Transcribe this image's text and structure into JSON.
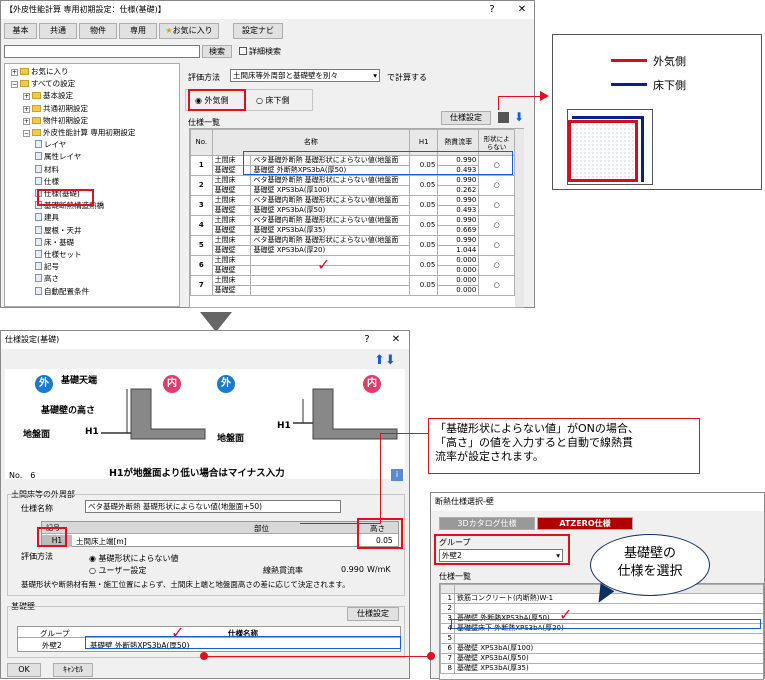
{
  "main_window": {
    "title": "【外皮性能計算 専用初期設定：仕様(基礎)】",
    "help": "?",
    "close": "✕",
    "toolbar": [
      "基本",
      "共通",
      "物件",
      "専用",
      "お気に入り",
      "設定ナビ"
    ],
    "search_button": "検索",
    "detail_search": "詳細検索",
    "tree": [
      {
        "label": "お気に入り",
        "indent": 0
      },
      {
        "label": "すべての設定",
        "indent": 0
      },
      {
        "label": "基本設定",
        "indent": 1
      },
      {
        "label": "共通初期設定",
        "indent": 1
      },
      {
        "label": "物件初期設定",
        "indent": 1
      },
      {
        "label": "外皮性能計算 専用初期設定",
        "indent": 1
      },
      {
        "label": "レイヤ",
        "indent": 2
      },
      {
        "label": "属性レイヤ",
        "indent": 2
      },
      {
        "label": "材料",
        "indent": 2
      },
      {
        "label": "仕様",
        "indent": 2
      },
      {
        "label": "仕様(基礎)",
        "indent": 2
      },
      {
        "label": "基礎断熱構造熱橋",
        "indent": 2
      },
      {
        "label": "建具",
        "indent": 2
      },
      {
        "label": "屋根・天井",
        "indent": 2
      },
      {
        "label": "床・基礎",
        "indent": 2
      },
      {
        "label": "仕様セット",
        "indent": 2
      },
      {
        "label": "記号",
        "indent": 2
      },
      {
        "label": "高さ",
        "indent": 2
      },
      {
        "label": "自動配置条件",
        "indent": 2
      }
    ],
    "eval_label": "評価方法",
    "eval_value": "土間床等外周部と基礎壁を別々",
    "eval_suffix": "で計算する",
    "radio_outside": "外気側",
    "radio_under": "床下側",
    "list_label": "仕様一覧",
    "spec_button": "仕様設定",
    "headers": [
      "No.",
      "名称",
      "H1",
      "熱貫流率",
      "形状によらない"
    ],
    "rows": [
      {
        "no": "1",
        "a": "土間床",
        "b": "基礎壁",
        "name1": "ベタ基礎外断熱 基礎形状によらない値(地盤面",
        "name2": "基礎壁 外断熱XPS3bA(厚50)",
        "h1": "0.05",
        "u1": "0.990",
        "u2": "0.493",
        "mark": "○"
      },
      {
        "no": "2",
        "a": "土間床",
        "b": "基礎壁",
        "name1": "ベタ基礎外断熱 基礎形状によらない値(地盤面",
        "name2": "基礎壁 XPS3bA(厚100)",
        "h1": "0.05",
        "u1": "0.990",
        "u2": "0.262",
        "mark": "○"
      },
      {
        "no": "3",
        "a": "土間床",
        "b": "基礎壁",
        "name1": "ベタ基礎内断熱 基礎形状によらない値(地盤面",
        "name2": "基礎壁 XPS3bA(厚50)",
        "h1": "0.05",
        "u1": "0.990",
        "u2": "0.493",
        "mark": "○"
      },
      {
        "no": "4",
        "a": "土間床",
        "b": "基礎壁",
        "name1": "ベタ基礎内断熱 基礎形状によらない値(地盤面",
        "name2": "基礎壁 XPS3bA(厚35)",
        "h1": "0.05",
        "u1": "0.990",
        "u2": "0.669",
        "mark": "○"
      },
      {
        "no": "5",
        "a": "土間床",
        "b": "基礎壁",
        "name1": "ベタ基礎内断熱 基礎形状によらない値(地盤面",
        "name2": "基礎壁 XPS3bA(厚20)",
        "h1": "0.05",
        "u1": "0.990",
        "u2": "1.044",
        "mark": "○"
      },
      {
        "no": "6",
        "a": "土間床",
        "b": "基礎壁",
        "name1": "",
        "name2": "",
        "h1": "0.05",
        "u1": "0.000",
        "u2": "0.000",
        "mark": "○"
      },
      {
        "no": "7",
        "a": "土間床",
        "b": "基礎壁",
        "name1": "",
        "name2": "",
        "h1": "0.05",
        "u1": "0.000",
        "u2": "0.000",
        "mark": "○"
      }
    ]
  },
  "legend": {
    "outside": "外気側",
    "under": "床下側",
    "outside_color": "#d0101a",
    "under_color": "#0a1f8a"
  },
  "dialog": {
    "title": "仕様設定(基礎)",
    "help": "?",
    "close": "✕",
    "diagram": {
      "outside_badge": "外",
      "inside_badge": "内",
      "top_label": "基礎天端",
      "height_label": "基礎壁の高さ",
      "ground_label": "地盤面",
      "h1": "H1",
      "h1_right": "H1",
      "ground_right": "地盤面",
      "caption": "H1が地盤面より低い場合はマイナス入力"
    },
    "no": "No.　6",
    "group_perimeter": "土間床等の外周部",
    "spec_name_label": "仕様名称",
    "spec_name_value": "ベタ基礎外断熱 基礎形状によらない値(地盤面+50)",
    "col_part": "部位",
    "col_height": "高さ",
    "col_h1_head": "記号",
    "row_h1": "H1",
    "row_part": "土間床上端[m]",
    "row_height": "0.05",
    "eval_label": "評価方法",
    "radio_shape": "基礎形状によらない値",
    "radio_user": "ユーザー設定",
    "u_label": "線熱貫流率",
    "u_value": "0.990",
    "u_unit": "W/mK",
    "note": "基礎形状や断熱材有無・施工位置によらず、土間床上端と地盤面高さの差に応じて決定されます。",
    "group_wall": "基礎壁",
    "spec_button": "仕様設定",
    "col_group": "グループ",
    "col_name": "仕様名称",
    "wall_group": "外壁2",
    "wall_name": "基礎壁 外断熱XPS3bA(厚50)",
    "ok": "OK",
    "cancel": "ｷｬﾝｾﾙ"
  },
  "callout": {
    "lines": [
      "「基礎形状によらない値」がONの場合、",
      "「高さ」の値を入力すると自動で線熱貫",
      "流率が設定されます。"
    ]
  },
  "bubble": {
    "line1": "基礎壁の",
    "line2": "仕様を選択"
  },
  "select_dialog": {
    "title": "断熱仕様選択-壁",
    "tab_3d": "3Dカタログ仕様",
    "tab_atzero": "ATZERO仕様",
    "group_label": "グループ",
    "group_value": "外壁2",
    "list_label": "仕様一覧",
    "rows": [
      {
        "no": "1",
        "name": "鉄筋コンクリート(内断熱)W-1"
      },
      {
        "no": "2",
        "name": ""
      },
      {
        "no": "3",
        "name": "基礎壁 外断熱XPS3bA(厚50)"
      },
      {
        "no": "4",
        "name": "基礎壁床下 外断熱XPS3bA(厚20)"
      },
      {
        "no": "5",
        "name": ""
      },
      {
        "no": "6",
        "name": "基礎壁 XPS3bA(厚100)"
      },
      {
        "no": "7",
        "name": "基礎壁 XPS3bA(厚50)"
      },
      {
        "no": "8",
        "name": "基礎壁 XPS3bA(厚35)"
      }
    ]
  }
}
